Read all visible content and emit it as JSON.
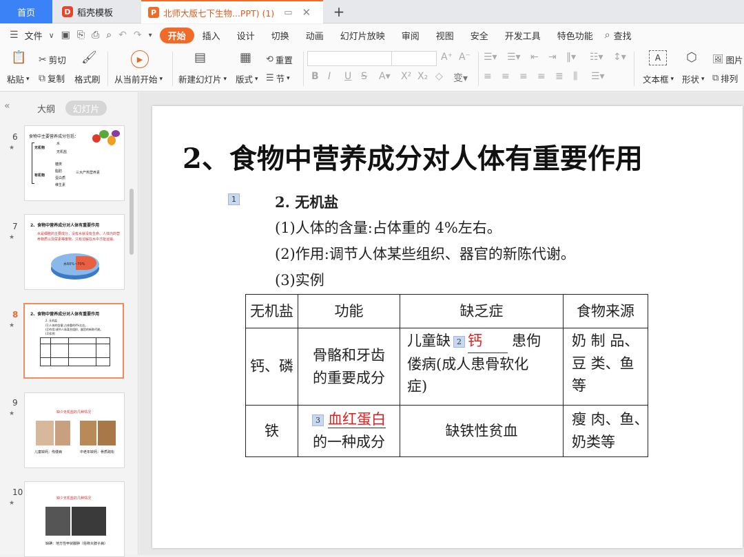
{
  "tabs": {
    "home": "首页",
    "templates": "稻壳模板",
    "doc": "北师大版七下生物...PPT)  (1)",
    "add": "+"
  },
  "menu": {
    "file": "文件",
    "items": [
      "开始",
      "插入",
      "设计",
      "切换",
      "动画",
      "幻灯片放映",
      "审阅",
      "视图",
      "安全",
      "开发工具",
      "特色功能"
    ],
    "search": "查找"
  },
  "ribbon": {
    "paste": "粘贴",
    "cut": "剪切",
    "copy": "复制",
    "format_painter": "格式刷",
    "from_current": "从当前开始",
    "new_slide": "新建幻灯片",
    "layout": "版式",
    "reset": "重置",
    "section": "节",
    "textbox": "文本框",
    "shape": "形状",
    "picture": "图片",
    "arrange": "排列"
  },
  "panel": {
    "outline": "大纲",
    "slides": "幻灯片"
  },
  "thumbnails": [
    {
      "num": "6",
      "title": "食物中主要营养成分包括：",
      "lines": [
        "无机物",
        "水",
        "无机盐",
        "有机物",
        "糖类",
        "脂肪",
        "蛋白质",
        "维生素",
        "三大产热营养素"
      ]
    },
    {
      "num": "7",
      "title": "2、食物中营养成分对人体有重要作用",
      "lines": [
        "水是细胞的主要成分，没有水就没有生命。人体内的营养物质以及尿素等废物，只有溶解在水中才能运输。",
        "水60%~70%"
      ]
    },
    {
      "num": "8",
      "title": "2、食物中营养成分对人体有重要作用",
      "lines": [
        "2. 无机盐",
        "(1)人体的含量:占体重的4%左右。",
        "(2)作用:调节人体某些组织、器官的新陈代谢。",
        "(3)实例"
      ]
    },
    {
      "num": "9",
      "title": "缺少无机盐的几种情况",
      "lines": [
        "儿童缺钙：佝偻病",
        "中老年缺钙：骨质疏松"
      ]
    },
    {
      "num": "10",
      "title": "缺少无机盐的几种情况",
      "lines": [
        "缺碘：地方性甲状腺肿（俗称大脖子病）"
      ]
    }
  ],
  "slide": {
    "title": "2、食物中营养成分对人体有重要作用",
    "anim1": "1",
    "anim2": "2",
    "anim3": "3",
    "heading": "2. 无机盐",
    "line1": "(1)人体的含量:占体重的 4%左右。",
    "line2": "(2)作用:调节人体某些组织、器官的新陈代谢。",
    "line3": "(3)实例",
    "table": {
      "headers": [
        "无机盐",
        "功能",
        "缺乏症",
        "食物来源"
      ],
      "row1": {
        "mineral": "钙、磷",
        "func_a": "骨骼和牙齿",
        "func_b": "的重要成分",
        "def_pre": "儿童缺",
        "def_blank": "钙",
        "def_post": "患佝",
        "def_line2": "偻病(成人患骨软化",
        "def_line3": "症)",
        "src_a": "奶 制 品、",
        "src_b": "豆 类、鱼",
        "src_c": "等"
      },
      "row2": {
        "mineral": "铁",
        "func_blank": "血红蛋白",
        "func_b": "的一种成分",
        "deficiency": "缺铁性贫血",
        "src_a": "瘦 肉、鱼、",
        "src_b": "奶类等"
      }
    }
  }
}
